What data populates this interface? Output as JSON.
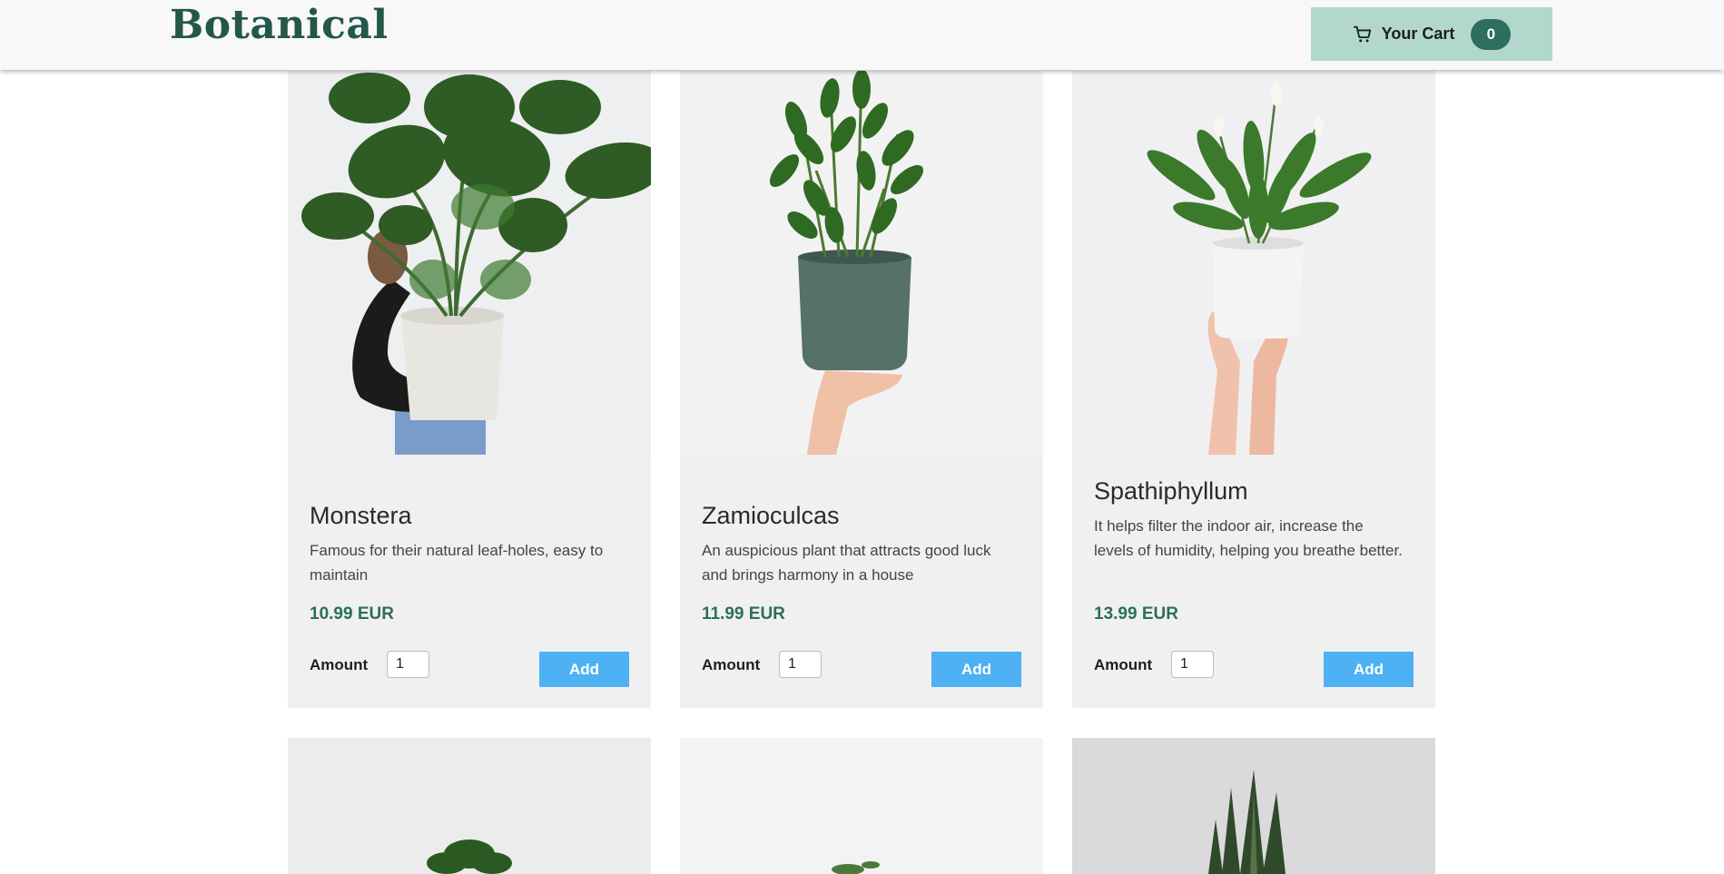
{
  "header": {
    "logo": "Botanical",
    "cart_label": "Your Cart",
    "cart_count": "0"
  },
  "products": [
    {
      "name": "Monstera",
      "description": "Famous for their natural leaf-holes, easy to maintain",
      "price": "10.99 EUR",
      "amount_label": "Amount",
      "amount_value": "1",
      "add_label": "Add"
    },
    {
      "name": "Zamioculcas",
      "description": "An auspicious plant that attracts good luck and brings harmony in a house",
      "price": "11.99 EUR",
      "amount_label": "Amount",
      "amount_value": "1",
      "add_label": "Add"
    },
    {
      "name": "Spathiphyllum",
      "description": "It helps filter the indoor air, increase the levels of humidity, helping you breathe better.",
      "price": "13.99 EUR",
      "amount_label": "Amount",
      "amount_value": "1",
      "add_label": "Add"
    }
  ],
  "icons": {
    "cart": "shopping-cart-icon"
  },
  "colors": {
    "brand": "#22574a",
    "accent": "#4db1f4",
    "cart_bg": "#b2d8ce",
    "badge": "#2d6e5c"
  }
}
